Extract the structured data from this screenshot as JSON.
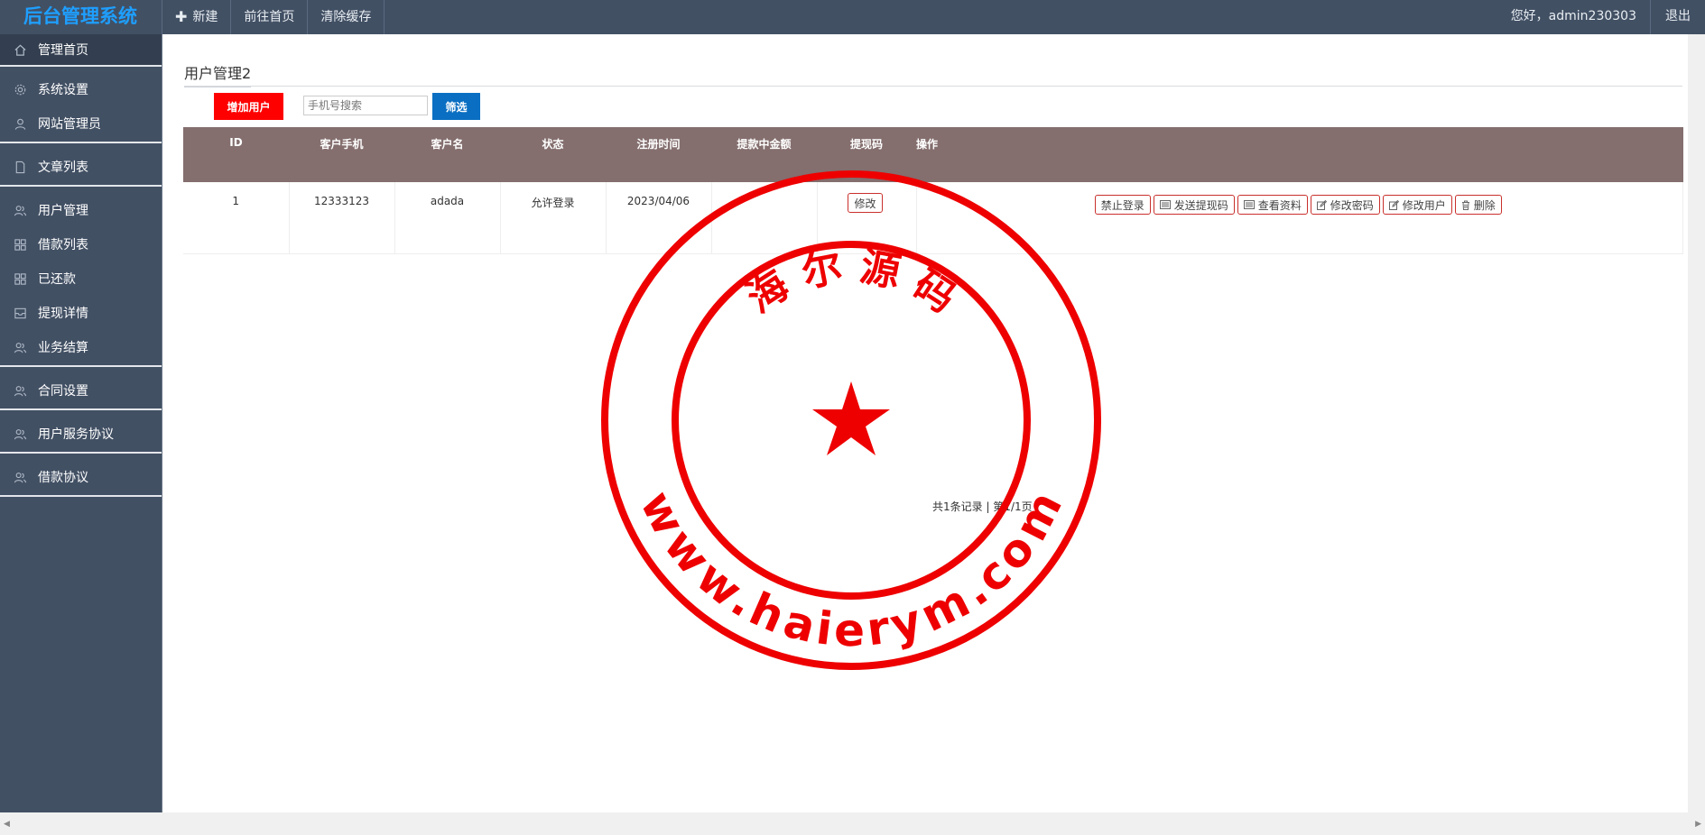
{
  "brand": {
    "title": "后台管理系统"
  },
  "topnav": [
    {
      "label": "新建",
      "icon": "plus-icon"
    },
    {
      "label": "前往首页"
    },
    {
      "label": "清除缓存"
    }
  ],
  "header": {
    "welcome": "您好，admin230303",
    "logout": "退出"
  },
  "sidebar": {
    "items": [
      {
        "label": "管理首页",
        "icon": "home-icon"
      },
      {
        "label": "系统设置",
        "icon": "gear-icon"
      },
      {
        "label": "网站管理员",
        "icon": "user-icon"
      },
      {
        "label": "文章列表",
        "icon": "document-icon"
      },
      {
        "label": "用户管理",
        "icon": "users-icon"
      },
      {
        "label": "借款列表",
        "icon": "grid-icon"
      },
      {
        "label": "已还款",
        "icon": "grid-icon"
      },
      {
        "label": "提现详情",
        "icon": "inbox-icon"
      },
      {
        "label": "业务结算",
        "icon": "users-icon"
      },
      {
        "label": "合同设置",
        "icon": "users-icon"
      },
      {
        "label": "用户服务协议",
        "icon": "users-icon"
      },
      {
        "label": "借款协议",
        "icon": "users-icon"
      }
    ]
  },
  "main": {
    "title": "用户管理2",
    "add_button": "增加用户",
    "search": {
      "placeholder": "手机号搜索",
      "value": ""
    },
    "filter_button": "筛选",
    "table": {
      "columns": [
        "ID",
        "客户手机",
        "客户名",
        "状态",
        "注册时间",
        "提款中金额",
        "提现码",
        "操作"
      ],
      "rows": [
        {
          "id": "1",
          "phone": "12333123",
          "name": "adada",
          "status": "允许登录",
          "reg_time": "2023/04/06",
          "amount": "",
          "code_button": "修改"
        }
      ],
      "actions": [
        {
          "label": "禁止登录",
          "icon": ""
        },
        {
          "label": "发送提现码",
          "icon": "list-icon"
        },
        {
          "label": "查看资料",
          "icon": "list-icon"
        },
        {
          "label": "修改密码",
          "icon": "edit-icon"
        },
        {
          "label": "修改用户",
          "icon": "edit-icon"
        },
        {
          "label": "删除",
          "icon": "trash-icon"
        }
      ]
    },
    "pagination": "共1条记录 | 第1/1页"
  },
  "watermark": {
    "top_text": "海 尔 源 码",
    "bottom_text": "www.haierym.com",
    "color": "#ee0000"
  },
  "colors": {
    "topbar": "#425064",
    "brand": "#1e9fff",
    "table_header": "#846e6e",
    "add_button": "#ff0000",
    "filter_button": "#0a6fc2"
  }
}
